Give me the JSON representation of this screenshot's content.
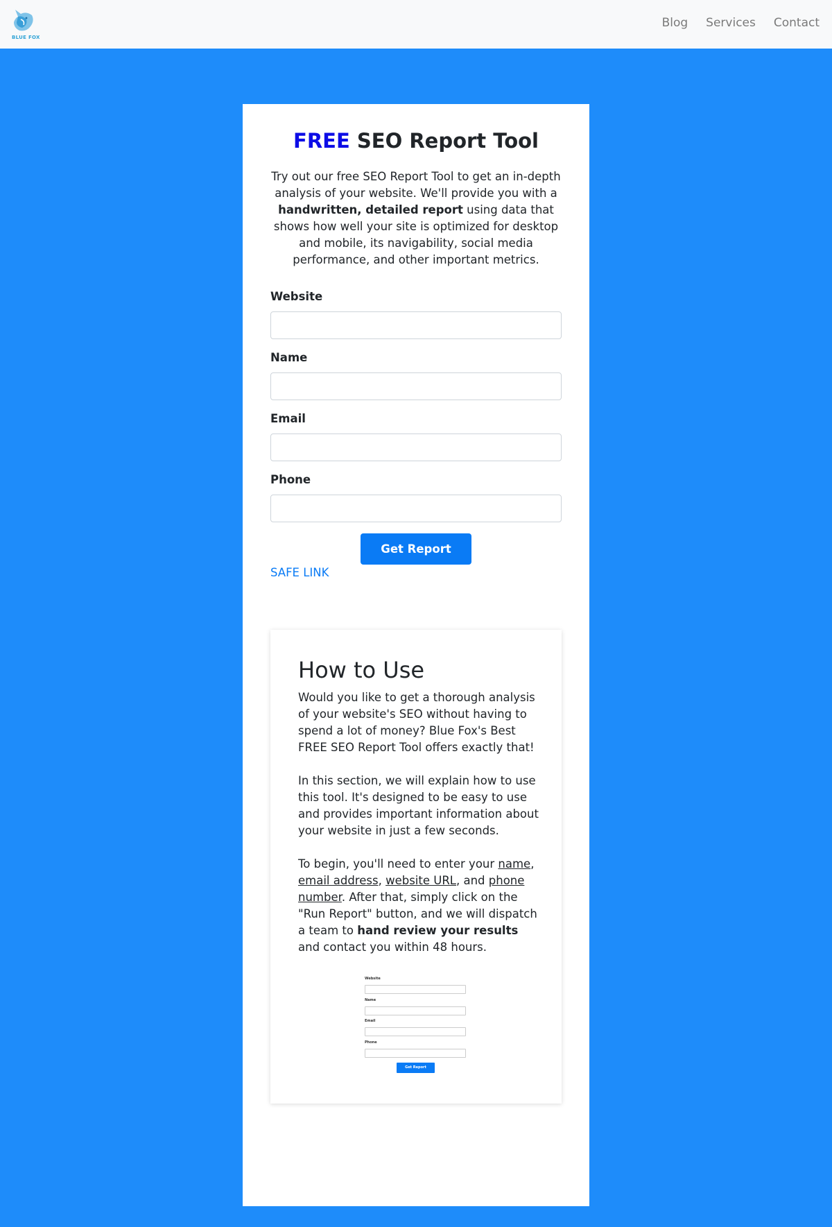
{
  "header": {
    "logo_text": "BLUE FOX",
    "nav": [
      {
        "label": "Blog"
      },
      {
        "label": "Services"
      },
      {
        "label": "Contact"
      }
    ]
  },
  "main": {
    "title_highlight": "FREE",
    "title_rest": " SEO Report Tool",
    "intro_before": "Try out our free SEO Report Tool to get an in-depth analysis of your website. We'll provide you with a ",
    "intro_bold": "handwritten, detailed report",
    "intro_after": " using data that shows how well your site is optimized for desktop and mobile, its navigability, social media performance, and other important metrics.",
    "form": {
      "website_label": "Website",
      "name_label": "Name",
      "email_label": "Email",
      "phone_label": "Phone",
      "submit_label": "Get Report"
    },
    "safe_link": "SAFE LINK"
  },
  "howto": {
    "title": "How to Use",
    "p1": "Would you like to get a thorough analysis of your website's SEO without having to spend a lot of money? Blue Fox's Best FREE SEO Report Tool offers exactly that!",
    "p2": "In this section, we will explain how to use this tool. It's designed to be easy to use and provides important information about your website in just a few seconds.",
    "p3_a": "To begin, you'll need to enter your ",
    "p3_name": "name",
    "p3_b": ", ",
    "p3_email": "email address",
    "p3_c": ", ",
    "p3_url": "website URL",
    "p3_d": ", and ",
    "p3_phone": "phone number",
    "p3_e": ". After that, simply click on the \"Run Report\" button, and we will dispatch a team to ",
    "p3_bold": "hand review your results",
    "p3_f": " and contact you within 48 hours.",
    "preview": {
      "website_label": "Website",
      "name_label": "Name",
      "email_label": "Email",
      "phone_label": "Phone",
      "button_label": "Get Report"
    }
  },
  "colors": {
    "page_background": "#1e8cfa",
    "accent": "#0a7bf5",
    "free_highlight": "#0d0de6"
  }
}
